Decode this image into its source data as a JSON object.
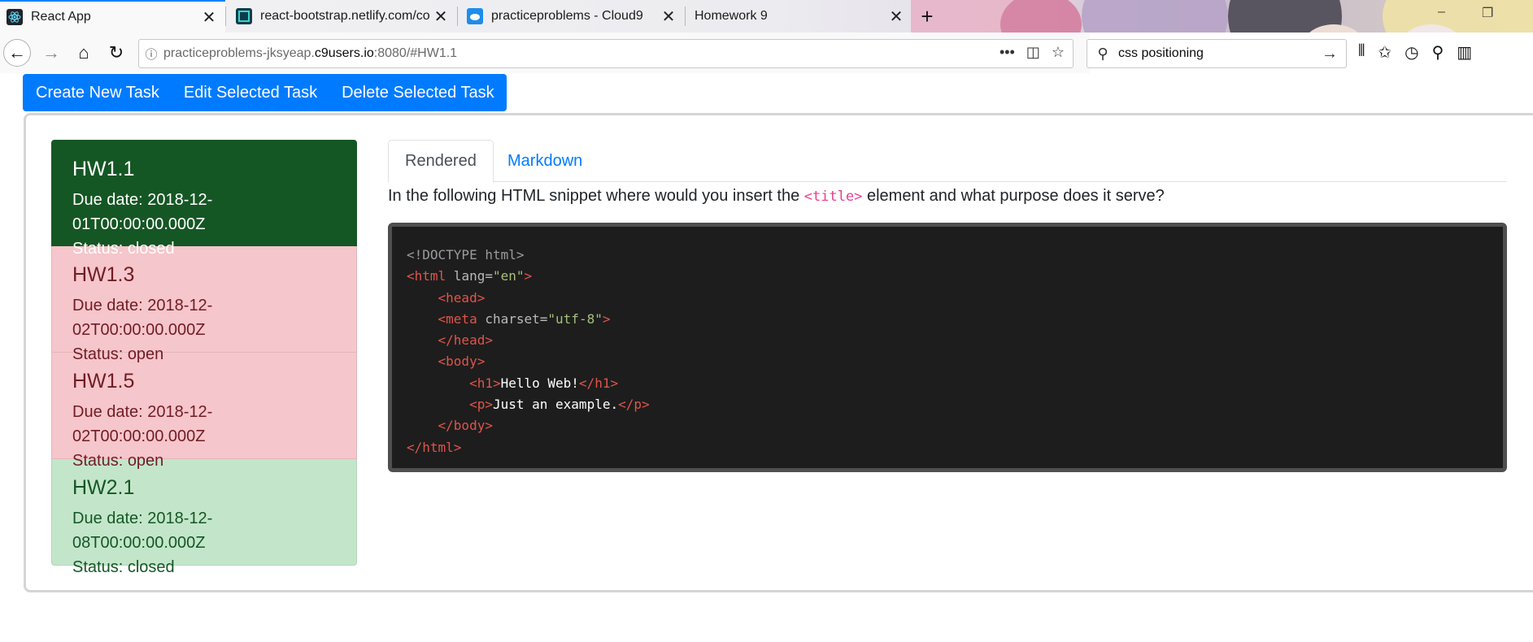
{
  "browser": {
    "tabs": [
      {
        "title": "React App",
        "active": true,
        "close": "✕"
      },
      {
        "title": "react-bootstrap.netlify.com/co",
        "active": false,
        "close": "✕"
      },
      {
        "title": "practiceproblems - Cloud9",
        "active": false,
        "close": "✕"
      },
      {
        "title": "Homework 9",
        "active": false,
        "close": "✕"
      }
    ],
    "url": {
      "prefix": "practiceproblems-jksyeap.",
      "domain": "c9users.io",
      "suffix": ":8080/#HW1.1"
    },
    "search": {
      "query": "css positioning"
    }
  },
  "toolbar": {
    "create_label": "Create New Task",
    "edit_label": "Edit Selected Task",
    "delete_label": "Delete Selected Task"
  },
  "tasks": [
    {
      "title": "HW1.1",
      "due": "Due date: 2018-12-01T00:00:00.000Z",
      "status": "Status: closed",
      "variant": "active"
    },
    {
      "title": "HW1.3",
      "due": "Due date: 2018-12-02T00:00:00.000Z",
      "status": "Status: open",
      "variant": "danger"
    },
    {
      "title": "HW1.5",
      "due": "Due date: 2018-12-02T00:00:00.000Z",
      "status": "Status: open",
      "variant": "danger"
    },
    {
      "title": "HW2.1",
      "due": "Due date: 2018-12-08T00:00:00.000Z",
      "status": "Status: closed",
      "variant": "success"
    }
  ],
  "detail": {
    "tabs": {
      "rendered": "Rendered",
      "markdown": "Markdown"
    },
    "question": {
      "before": "In the following HTML snippet where would you insert the ",
      "code": "<title>",
      "after": " element and what purpose does it serve?"
    },
    "code": {
      "doctype": "<!DOCTYPE html>",
      "html_open": "<html",
      "html_attr": " lang=",
      "html_attr_val": "\"en\"",
      "html_close_bracket": ">",
      "head_open": "<head>",
      "meta_open": "<meta",
      "meta_attr": " charset=",
      "meta_attr_val": "\"utf-8\"",
      "meta_close_bracket": ">",
      "head_close": "</head>",
      "body_open": "<body>",
      "h1_open": "<h1>",
      "h1_text": "Hello Web!",
      "h1_close": "</h1>",
      "p_open": "<p>",
      "p_text": "Just an example.",
      "p_close": "</p>",
      "body_close": "</body>",
      "html_close": "</html>"
    }
  },
  "colors": {
    "primary": "#007bff",
    "task_active": "#155724",
    "task_danger": "#f5c6cb",
    "task_success": "#c3e6cb",
    "code_bg": "#1d1d1d"
  }
}
